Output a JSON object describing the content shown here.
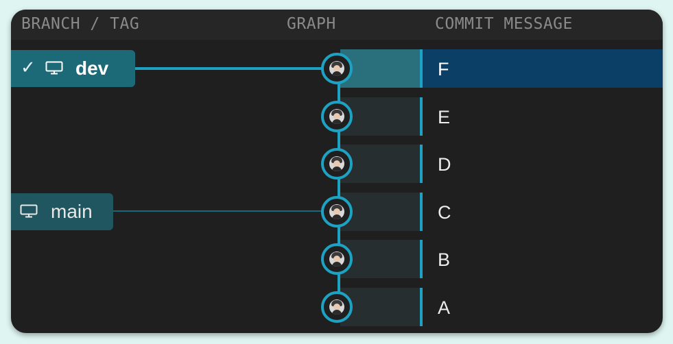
{
  "header": {
    "branch_tag": "BRANCH / TAG",
    "graph": "GRAPH",
    "commit_message": "COMMIT MESSAGE"
  },
  "branches": [
    {
      "label": "dev",
      "checked_out": true,
      "icon": "monitor-icon",
      "check_icon": "checkmark-icon",
      "check_glyph": "✓",
      "commit": "F"
    },
    {
      "label": "main",
      "checked_out": false,
      "icon": "monitor-icon",
      "commit": "C"
    }
  ],
  "commits": [
    {
      "message": "F",
      "selected": true
    },
    {
      "message": "E",
      "selected": false
    },
    {
      "message": "D",
      "selected": false
    },
    {
      "message": "C",
      "selected": false
    },
    {
      "message": "B",
      "selected": false
    },
    {
      "message": "A",
      "selected": false
    }
  ],
  "colors": {
    "accent": "#1ea2c3",
    "selected_row": "#0b3f66",
    "branch_active": "#1c6a78",
    "branch_inactive": "#1f5660",
    "panel_bg": "#1f1f1f",
    "page_bg": "#def5f1"
  }
}
